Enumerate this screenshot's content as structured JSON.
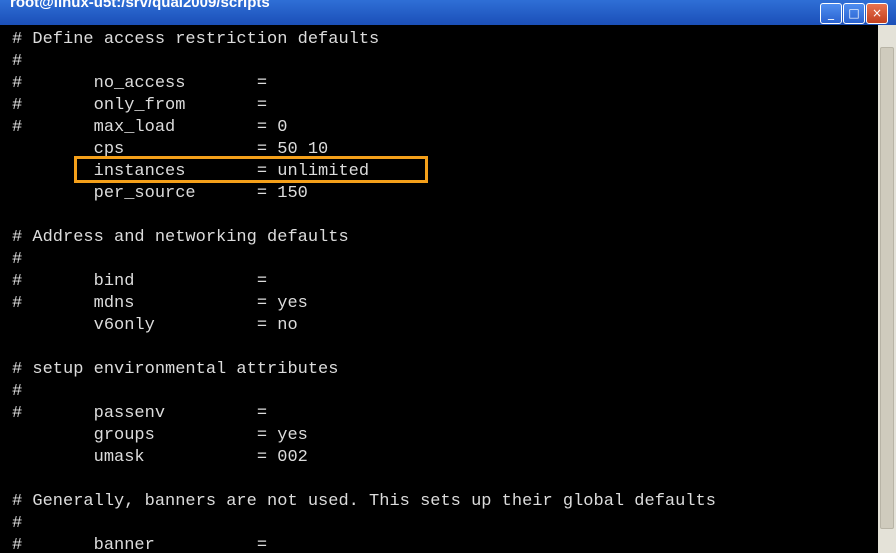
{
  "window": {
    "title": "root@linux-u5t:/srv/qual2009/scripts",
    "min_glyph": "_",
    "max_glyph": "□",
    "close_glyph": "×"
  },
  "terminal": {
    "lines": [
      "# Define access restriction defaults",
      "#",
      "#       no_access       =",
      "#       only_from       =",
      "#       max_load        = 0",
      "        cps             = 50 10",
      "        instances       = unlimited",
      "        per_source      = 150",
      "",
      "# Address and networking defaults",
      "#",
      "#       bind            =",
      "#       mdns            = yes",
      "        v6only          = no",
      "",
      "# setup environmental attributes",
      "#",
      "#       passenv         =",
      "        groups          = yes",
      "        umask           = 002",
      "",
      "# Generally, banners are not used. This sets up their global defaults",
      "#",
      "#       banner          ="
    ]
  },
  "annotation": {
    "highlight_color": "#f5a01a"
  }
}
